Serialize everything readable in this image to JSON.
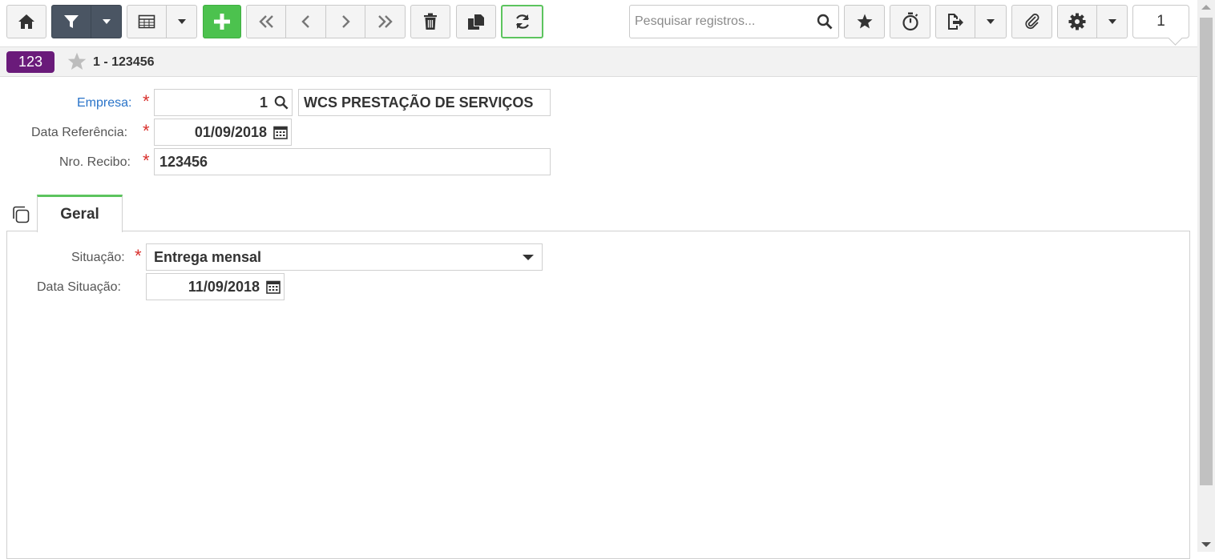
{
  "toolbar": {
    "search_placeholder": "Pesquisar registros...",
    "record_counter": "1"
  },
  "record": {
    "badge": "123",
    "title": "1 - 123456"
  },
  "form": {
    "empresa_label": "Empresa:",
    "empresa_code": "1",
    "empresa_name": "WCS PRESTAÇÃO DE SERVIÇOS",
    "data_referencia_label": "Data Referência:",
    "data_referencia": "01/09/2018",
    "nro_recibo_label": "Nro. Recibo:",
    "nro_recibo": "123456",
    "required_mark": "*"
  },
  "tabs": [
    {
      "label": "Geral"
    }
  ],
  "geral": {
    "situacao_label": "Situação:",
    "situacao_value": "Entrega mensal",
    "data_situacao_label": "Data Situação:",
    "data_situacao": "11/09/2018"
  },
  "colors": {
    "accent_green": "#4cc24e",
    "badge_purple": "#6a1b7a",
    "link_blue": "#2a74c9",
    "required_red": "#d9302c",
    "dark_button": "#4a5563"
  }
}
